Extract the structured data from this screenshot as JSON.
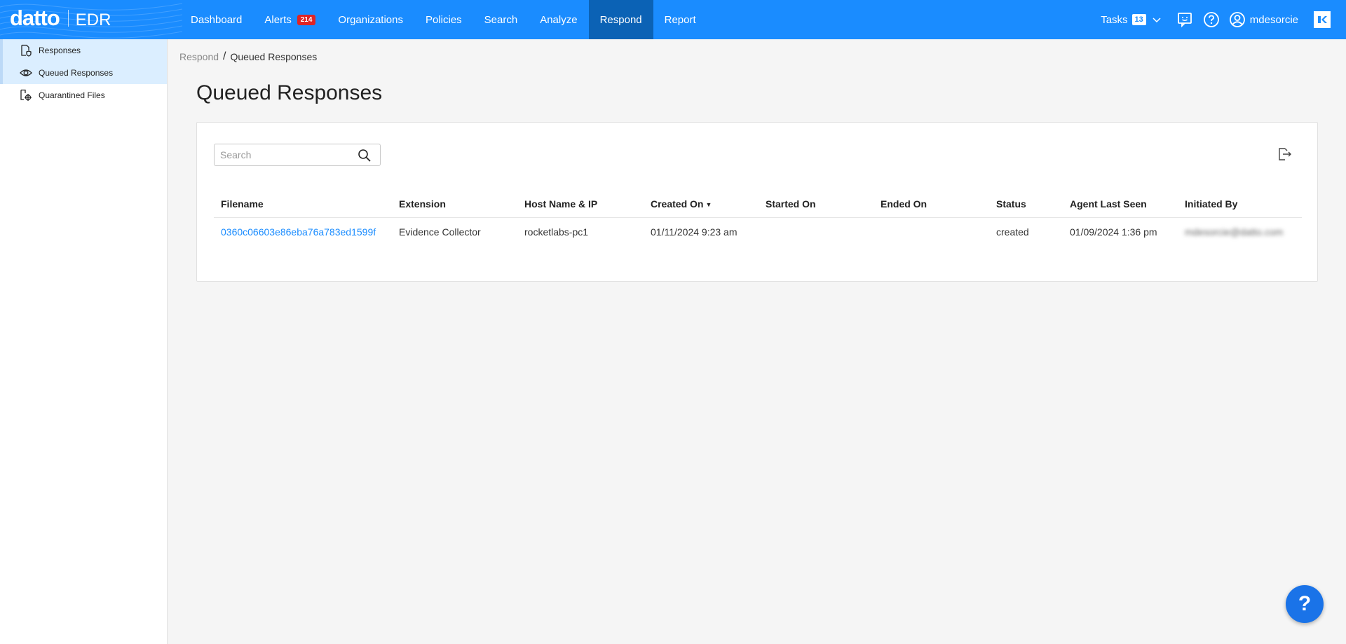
{
  "brand": {
    "name": "datto",
    "product": "EDR"
  },
  "nav": {
    "items": [
      {
        "label": "Dashboard"
      },
      {
        "label": "Alerts",
        "badge": "214"
      },
      {
        "label": "Organizations"
      },
      {
        "label": "Policies"
      },
      {
        "label": "Search"
      },
      {
        "label": "Analyze"
      },
      {
        "label": "Respond",
        "active": true
      },
      {
        "label": "Report"
      }
    ],
    "tasks_label": "Tasks",
    "tasks_count": "13",
    "username": "mdesorcie"
  },
  "sidebar": {
    "items": [
      {
        "label": "Responses",
        "icon": "file-shield-icon"
      },
      {
        "label": "Queued Responses",
        "icon": "eye-icon",
        "selected": true
      },
      {
        "label": "Quarantined Files",
        "icon": "quarantine-icon"
      }
    ]
  },
  "breadcrumb": {
    "parent": "Respond",
    "current": "Queued Responses"
  },
  "page": {
    "title": "Queued Responses"
  },
  "search": {
    "placeholder": "Search",
    "value": ""
  },
  "table": {
    "headers": [
      "Filename",
      "Extension",
      "Host Name & IP",
      "Created On",
      "Started On",
      "Ended On",
      "Status",
      "Agent Last Seen",
      "Initiated By"
    ],
    "sorted_column": "Created On",
    "rows": [
      {
        "filename": "0360c06603e86eba76a783ed1599f",
        "extension": "Evidence Collector",
        "host": "rocketlabs-pc1",
        "created_on": "01/11/2024 9:23 am",
        "started_on": "",
        "ended_on": "",
        "status": "created",
        "agent_last_seen": "01/09/2024 1:36 pm",
        "initiated_by": "mdesorcie@datto.com"
      }
    ]
  },
  "colors": {
    "primary": "#1a8cff",
    "nav_active": "#0b62b5",
    "badge": "#e02424"
  },
  "help": {
    "label": "?"
  }
}
